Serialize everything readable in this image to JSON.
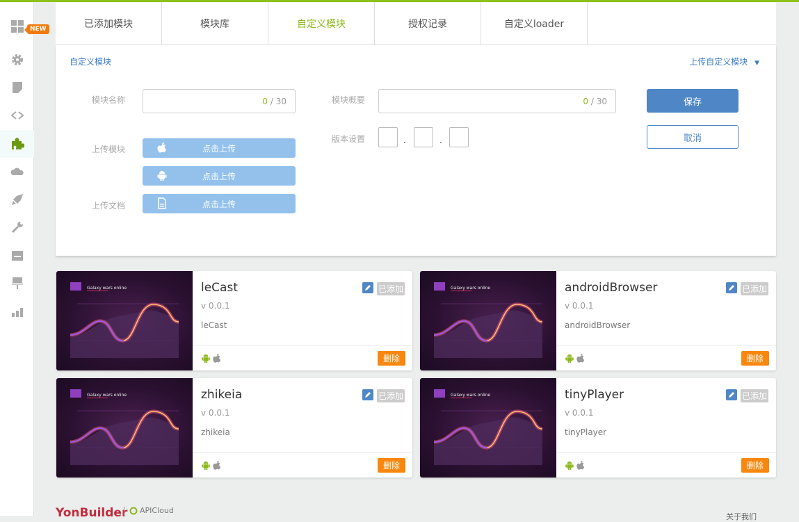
{
  "sidebar": {
    "new_badge": "NEW",
    "items": [
      "dashboard",
      "settings",
      "docs",
      "code",
      "modules",
      "cloud",
      "publish",
      "tools",
      "terminal",
      "ads",
      "stats"
    ],
    "active": "modules"
  },
  "tabs": [
    "已添加模块",
    "模块库",
    "自定义模块",
    "授权记录",
    "自定义loader"
  ],
  "active_tab": "自定义模块",
  "panel": {
    "breadcrumb": "自定义模块",
    "upload_custom": "上传自定义模块",
    "name_label": "模块名称",
    "name_count": "0",
    "name_max": "/ 30",
    "summary_label": "模块概要",
    "summary_count": "0",
    "summary_max": "/ 30",
    "version_label": "版本设置",
    "version_sep": ".",
    "upload_module_label": "上传模块",
    "upload_doc_label": "上传文档",
    "upload_btn": "点击上传",
    "save": "保存",
    "cancel": "取消"
  },
  "cards": [
    {
      "name": "leCast",
      "version": "v 0.0.1",
      "desc": "leCast",
      "status": "已添加",
      "delete": "删除",
      "thumb_title": "Galaxy wars online"
    },
    {
      "name": "androidBrowser",
      "version": "v 0.0.1",
      "desc": "androidBrowser",
      "status": "已添加",
      "delete": "删除",
      "thumb_title": "Galaxy wars online"
    },
    {
      "name": "zhikeia",
      "version": "v 0.0.1",
      "desc": "zhikeia",
      "status": "已添加",
      "delete": "删除",
      "thumb_title": "Galaxy wars online"
    },
    {
      "name": "tinyPlayer",
      "version": "v 0.0.1",
      "desc": "tinyPlayer",
      "status": "已添加",
      "delete": "删除",
      "thumb_title": "Galaxy wars online"
    }
  ],
  "footer": {
    "logo": "YonBuilder",
    "partner": "APICloud",
    "about": "关于我们"
  },
  "colors": {
    "accent": "#8cc21a",
    "primary": "#4f86c6",
    "danger": "#f7870f"
  }
}
